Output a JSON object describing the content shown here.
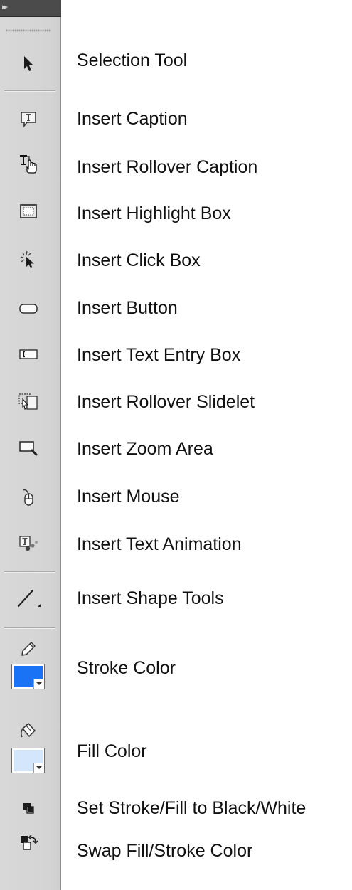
{
  "toolbar": {
    "tools": [
      {
        "id": "selection",
        "label": "Selection Tool",
        "icon": "arrow-pointer-icon"
      },
      {
        "id": "caption",
        "label": "Insert Caption",
        "icon": "caption-icon"
      },
      {
        "id": "rollover-caption",
        "label": "Insert Rollover Caption",
        "icon": "rollover-caption-icon"
      },
      {
        "id": "highlight-box",
        "label": "Insert Highlight Box",
        "icon": "highlight-box-icon"
      },
      {
        "id": "click-box",
        "label": "Insert Click Box",
        "icon": "click-box-icon"
      },
      {
        "id": "button",
        "label": "Insert Button",
        "icon": "button-icon"
      },
      {
        "id": "text-entry-box",
        "label": "Insert Text Entry Box",
        "icon": "text-entry-box-icon"
      },
      {
        "id": "rollover-slidelet",
        "label": "Insert Rollover Slidelet",
        "icon": "rollover-slidelet-icon"
      },
      {
        "id": "zoom-area",
        "label": "Insert Zoom Area",
        "icon": "zoom-area-icon"
      },
      {
        "id": "mouse",
        "label": "Insert Mouse",
        "icon": "mouse-icon"
      },
      {
        "id": "text-animation",
        "label": "Insert Text Animation",
        "icon": "text-animation-icon"
      },
      {
        "id": "shape-tools",
        "label": "Insert Shape Tools",
        "icon": "line-shape-icon"
      }
    ],
    "stroke_color": {
      "label": "Stroke Color",
      "icon": "pencil-icon",
      "color": "#1a73f5"
    },
    "fill_color": {
      "label": "Fill Color",
      "icon": "paint-bucket-icon",
      "color": "#d3e6fc"
    },
    "default_colors": {
      "label": "Set Stroke/Fill to Black/White",
      "icon": "default-colors-icon"
    },
    "swap_colors": {
      "label": "Swap Fill/Stroke Color",
      "icon": "swap-colors-icon"
    }
  }
}
